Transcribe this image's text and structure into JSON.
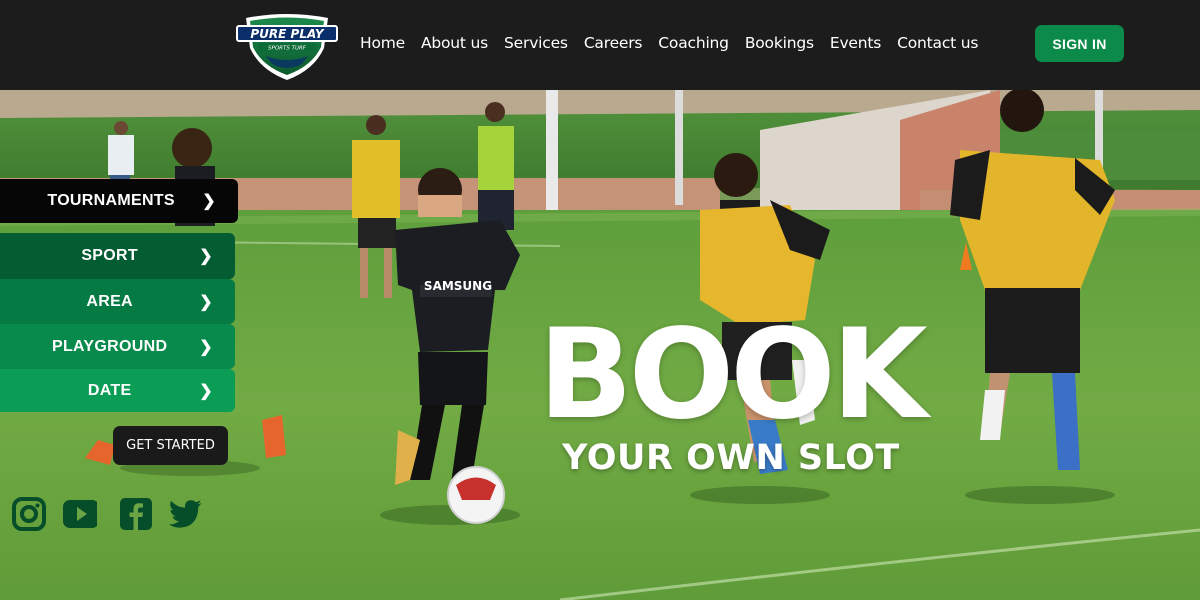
{
  "header": {
    "logo_text": "PURE PLAY",
    "logo_subtext": "SPORTS TURF",
    "nav": [
      "Home",
      "About us",
      "Services",
      "Careers",
      "Coaching",
      "Bookings",
      "Events",
      "Contact us"
    ],
    "signin_label": "SIGN IN"
  },
  "hero": {
    "headline": "BOOK",
    "subheadline": "YOUR OWN SLOT",
    "jersey_text": "SAMSUNG"
  },
  "filters": {
    "items": [
      {
        "label": "TOURNAMENTS",
        "chevron": "❯"
      },
      {
        "label": "SPORT",
        "chevron": "❯"
      },
      {
        "label": "AREA",
        "chevron": "❯"
      },
      {
        "label": "PLAYGROUND",
        "chevron": "❯"
      },
      {
        "label": "DATE",
        "chevron": "❯"
      }
    ],
    "cta_label": "GET STARTED"
  },
  "social": {
    "icons": [
      "instagram-icon",
      "youtube-icon",
      "facebook-icon",
      "twitter-icon"
    ]
  },
  "colors": {
    "accent_green": "#0b8a4a",
    "header_bg": "#1c1c1c",
    "social_green": "#064d2a"
  }
}
